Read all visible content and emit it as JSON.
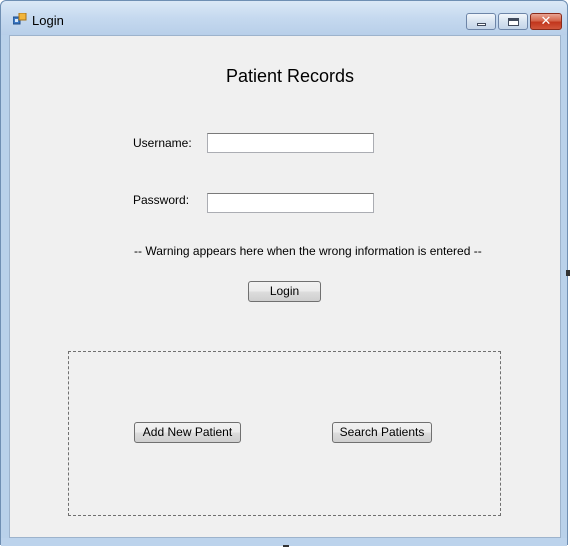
{
  "window": {
    "title": "Login",
    "icon": "application-icon",
    "controls": {
      "minimize": "minimize-icon",
      "maximize": "maximize-icon",
      "close": "close-icon",
      "close_glyph": "✕"
    }
  },
  "form": {
    "heading": "Patient Records",
    "username_label": "Username:",
    "username_value": "",
    "password_label": "Password:",
    "password_value": "",
    "warning_text": "-- Warning appears here when the wrong information is entered --",
    "login_button": "Login"
  },
  "actions": {
    "add_patient_button": "Add New Patient",
    "search_patients_button": "Search Patients"
  },
  "colors": {
    "form_background": "#f0f0f0",
    "title_bar": "#c5d9ef",
    "close_button": "#c2361d"
  }
}
